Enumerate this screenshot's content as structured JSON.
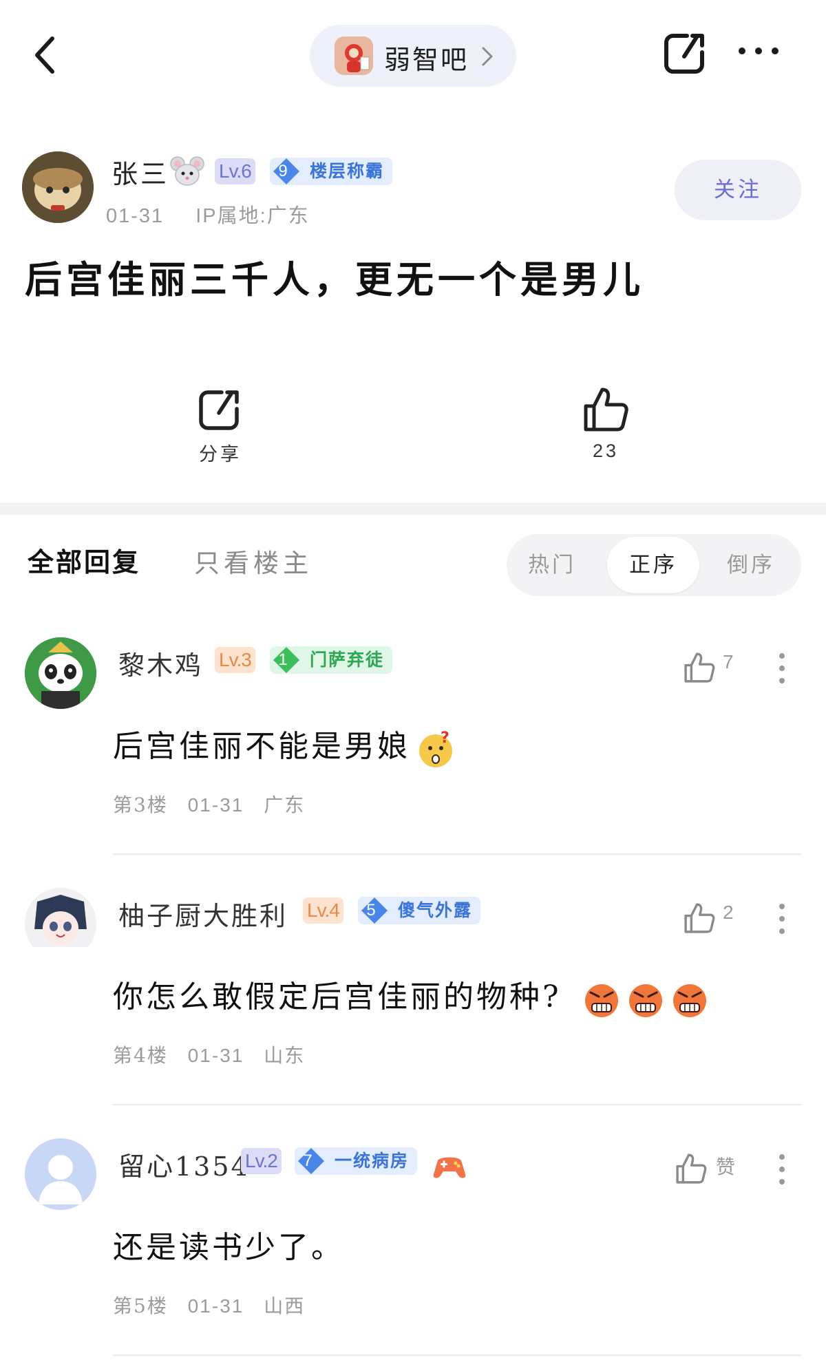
{
  "topbar": {
    "forum_name": "弱智吧"
  },
  "post": {
    "author": {
      "name": "张三",
      "level": "Lv.6",
      "badge_level": "9",
      "badge_title": "楼层称霸",
      "date": "01-31",
      "ip_location": "IP属地:广东"
    },
    "follow_label": "关注",
    "title": "后宫佳丽三千人，更无一个是男儿",
    "share_label": "分享",
    "like_count": "23"
  },
  "reply_tabs": {
    "all": "全部回复",
    "op_only": "只看楼主",
    "sort": [
      "热门",
      "正序",
      "倒序"
    ],
    "sort_active_index": 1
  },
  "comments": [
    {
      "name": "黎木鸡",
      "level": "Lv.3",
      "badge_level": "1",
      "badge_title": "门萨弃徒",
      "likes": "7",
      "text": "后宫佳丽不能是男娘",
      "floor": "第3楼",
      "date": "01-31",
      "location": "广东"
    },
    {
      "name": "柚子厨大胜利",
      "level": "Lv.4",
      "badge_level": "5",
      "badge_title": "傻气外露",
      "likes": "2",
      "text": "你怎么敢假定后宫佳丽的物种?",
      "floor": "第4楼",
      "date": "01-31",
      "location": "山东"
    },
    {
      "name": "留心1354",
      "level": "Lv.2",
      "badge_level": "7",
      "badge_title": "一统病房",
      "likes": "赞",
      "text": "还是读书少了。",
      "floor": "第5楼",
      "date": "01-31",
      "location": "山西"
    }
  ],
  "colors": {
    "accent": "#6a6bd8",
    "badge_blue": "#4a86e8",
    "badge_green": "#3cbf5a",
    "level_purple_bg": "#dcdcf7",
    "level_orange_bg": "#fde3cf"
  }
}
